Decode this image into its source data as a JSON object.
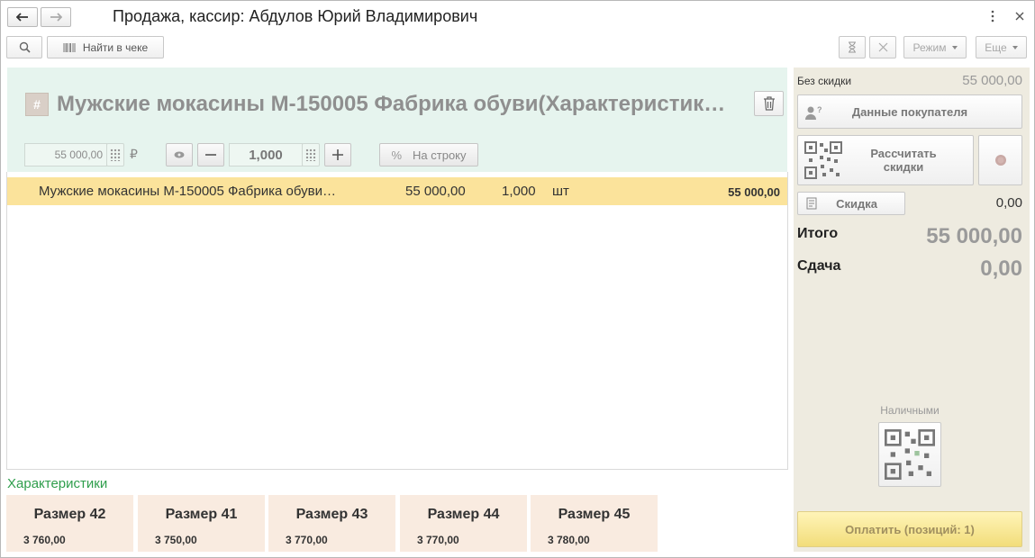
{
  "window": {
    "title": "Продажа, кассир: Абдулов Юрий Владимирович"
  },
  "toolbar": {
    "find_in_receipt": "Найти в чеке",
    "mode": "Режим",
    "more": "Еще"
  },
  "product": {
    "title": "Мужские мокасины М-150005 Фабрика обуви(Характеристик…",
    "price": "55 000,00",
    "currency": "₽",
    "quantity": "1,000",
    "to_line_label": "На строку",
    "percent_symbol": "%"
  },
  "receipt_lines": [
    {
      "name": "Мужские мокасины М-150005 Фабрика обуви…",
      "price": "55 000,00",
      "qty": "1,000",
      "unit": "шт",
      "sum": "55 000,00"
    }
  ],
  "characteristics": {
    "title": "Характеристики",
    "items": [
      {
        "name": "Размер 42",
        "price": "3 760,00"
      },
      {
        "name": "Размер 41",
        "price": "3 750,00"
      },
      {
        "name": "Размер 43",
        "price": "3 770,00"
      },
      {
        "name": "Размер 44",
        "price": "3 770,00"
      },
      {
        "name": "Размер 45",
        "price": "3 780,00"
      }
    ]
  },
  "summary": {
    "no_discount_label": "Без скидки",
    "no_discount_value": "55 000,00",
    "buyer_data": "Данные покупателя",
    "calc_discounts": "Рассчитать скидки",
    "discount_label": "Скидка",
    "discount_value": "0,00",
    "total_label": "Итого",
    "total_value": "55 000,00",
    "change_label": "Сдача",
    "change_value": "0,00",
    "cash_label": "Наличными",
    "pay_button": "Оплатить (позиций: 1)"
  },
  "colors": {
    "product_panel_bg": "#e6f4ee",
    "selected_row_bg": "#fbe39b",
    "tile_bg": "#f9ebe0",
    "right_panel_bg": "#eeebe0",
    "accent_green": "#2f9e4c"
  }
}
